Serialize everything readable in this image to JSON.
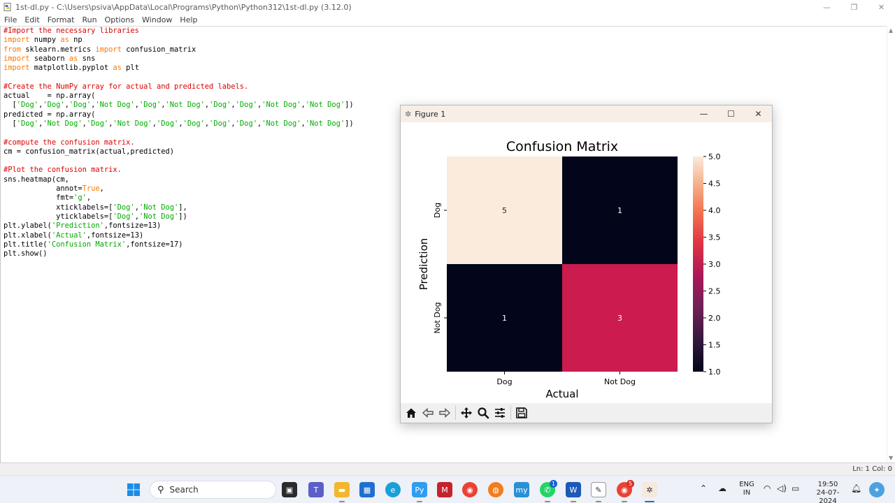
{
  "window": {
    "title": "1st-dl.py - C:\\Users\\psiva\\AppData\\Local\\Programs\\Python\\Python312\\1st-dl.py (3.12.0)",
    "minimize": "—",
    "maximize": "❐",
    "close": "✕"
  },
  "menu": [
    "File",
    "Edit",
    "Format",
    "Run",
    "Options",
    "Window",
    "Help"
  ],
  "code_lines": [
    [
      [
        "cm",
        "#Import the necessary libraries"
      ]
    ],
    [
      [
        "kw",
        "import"
      ],
      [
        "",
        " numpy "
      ],
      [
        "kw",
        "as"
      ],
      [
        "",
        " np"
      ]
    ],
    [
      [
        "kw",
        "from"
      ],
      [
        "",
        " sklearn.metrics "
      ],
      [
        "kw",
        "import"
      ],
      [
        "",
        " confusion_matrix"
      ]
    ],
    [
      [
        "kw",
        "import"
      ],
      [
        "",
        " seaborn "
      ],
      [
        "kw",
        "as"
      ],
      [
        "",
        " sns"
      ]
    ],
    [
      [
        "kw",
        "import"
      ],
      [
        "",
        " matplotlib.pyplot "
      ],
      [
        "kw",
        "as"
      ],
      [
        "",
        " plt"
      ]
    ],
    [],
    [
      [
        "cm",
        "#Create the NumPy array for actual and predicted labels."
      ]
    ],
    [
      [
        "",
        "actual    = np.array("
      ]
    ],
    [
      [
        "",
        "  ["
      ],
      [
        "st",
        "'Dog'"
      ],
      [
        "",
        ","
      ],
      [
        "st",
        "'Dog'"
      ],
      [
        "",
        ","
      ],
      [
        "st",
        "'Dog'"
      ],
      [
        "",
        ","
      ],
      [
        "st",
        "'Not Dog'"
      ],
      [
        "",
        ","
      ],
      [
        "st",
        "'Dog'"
      ],
      [
        "",
        ","
      ],
      [
        "st",
        "'Not Dog'"
      ],
      [
        "",
        ","
      ],
      [
        "st",
        "'Dog'"
      ],
      [
        "",
        ","
      ],
      [
        "st",
        "'Dog'"
      ],
      [
        "",
        ","
      ],
      [
        "st",
        "'Not Dog'"
      ],
      [
        "",
        ","
      ],
      [
        "st",
        "'Not Dog'"
      ],
      [
        "",
        "])"
      ]
    ],
    [
      [
        "",
        "predicted = np.array("
      ]
    ],
    [
      [
        "",
        "  ["
      ],
      [
        "st",
        "'Dog'"
      ],
      [
        "",
        ","
      ],
      [
        "st",
        "'Not Dog'"
      ],
      [
        "",
        ","
      ],
      [
        "st",
        "'Dog'"
      ],
      [
        "",
        ","
      ],
      [
        "st",
        "'Not Dog'"
      ],
      [
        "",
        ","
      ],
      [
        "st",
        "'Dog'"
      ],
      [
        "",
        ","
      ],
      [
        "st",
        "'Dog'"
      ],
      [
        "",
        ","
      ],
      [
        "st",
        "'Dog'"
      ],
      [
        "",
        ","
      ],
      [
        "st",
        "'Dog'"
      ],
      [
        "",
        ","
      ],
      [
        "st",
        "'Not Dog'"
      ],
      [
        "",
        ","
      ],
      [
        "st",
        "'Not Dog'"
      ],
      [
        "",
        "])"
      ]
    ],
    [],
    [
      [
        "cm",
        "#compute the confusion matrix."
      ]
    ],
    [
      [
        "",
        "cm = confusion_matrix(actual,predicted)"
      ]
    ],
    [],
    [
      [
        "cm",
        "#Plot the confusion matrix."
      ]
    ],
    [
      [
        "",
        "sns.heatmap(cm,"
      ]
    ],
    [
      [
        "",
        "            annot="
      ],
      [
        "kw",
        "True"
      ],
      [
        "",
        ","
      ]
    ],
    [
      [
        "",
        "            fmt="
      ],
      [
        "st",
        "'g'"
      ],
      [
        "",
        ","
      ]
    ],
    [
      [
        "",
        "            xticklabels=["
      ],
      [
        "st",
        "'Dog'"
      ],
      [
        "",
        ","
      ],
      [
        "st",
        "'Not Dog'"
      ],
      [
        "",
        "],"
      ]
    ],
    [
      [
        "",
        "            yticklabels=["
      ],
      [
        "st",
        "'Dog'"
      ],
      [
        "",
        ","
      ],
      [
        "st",
        "'Not Dog'"
      ],
      [
        "",
        "])"
      ]
    ],
    [
      [
        "",
        "plt.ylabel("
      ],
      [
        "st",
        "'Prediction'"
      ],
      [
        "",
        ",fontsize=13)"
      ]
    ],
    [
      [
        "",
        "plt.xlabel("
      ],
      [
        "st",
        "'Actual'"
      ],
      [
        "",
        ",fontsize=13)"
      ]
    ],
    [
      [
        "",
        "plt.title("
      ],
      [
        "st",
        "'Confusion Matrix'"
      ],
      [
        "",
        ",fontsize=17)"
      ]
    ],
    [
      [
        "",
        "plt.show()"
      ]
    ]
  ],
  "status": "Ln: 1   Col: 0",
  "figure": {
    "title": "Figure 1",
    "minimize": "—",
    "maximize": "☐",
    "close": "✕"
  },
  "chart_data": {
    "type": "heatmap",
    "title": "Confusion Matrix",
    "xlabel": "Actual",
    "ylabel": "Prediction",
    "x_categories": [
      "Dog",
      "Not Dog"
    ],
    "y_categories": [
      "Dog",
      "Not Dog"
    ],
    "values": [
      [
        5,
        1
      ],
      [
        1,
        3
      ]
    ],
    "colorbar": {
      "min": 1.0,
      "max": 5.0,
      "ticks": [
        "1.0",
        "1.5",
        "2.0",
        "2.5",
        "3.0",
        "3.5",
        "4.0",
        "4.5",
        "5.0"
      ]
    },
    "colormap": "rocket",
    "colors": {
      "5": "#faebdd",
      "3": "#cb1b4f",
      "1": "#03051a"
    }
  },
  "toolbar_icons": [
    "home-icon",
    "back-icon",
    "forward-icon",
    "pan-icon",
    "zoom-icon",
    "configure-subplots-icon",
    "save-icon"
  ],
  "taskbar": {
    "search_label": "Search",
    "language_top": "ENG",
    "language_bottom": "IN",
    "time": "19:50",
    "date": "24-07-2024",
    "whatsapp_badge": "1",
    "chrome_badge": "5"
  }
}
